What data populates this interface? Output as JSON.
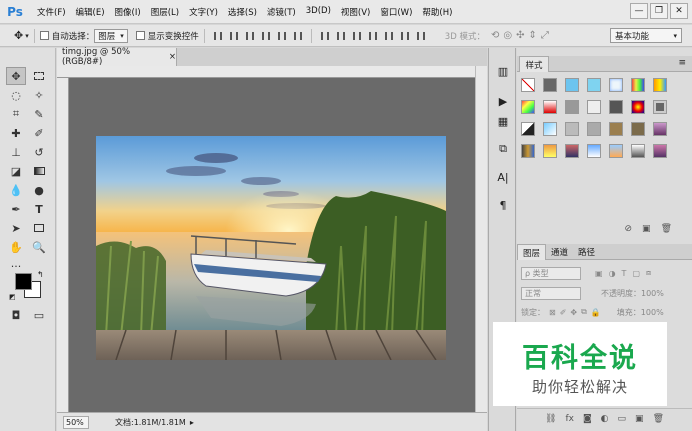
{
  "app": {
    "logo": "Ps"
  },
  "menu": [
    "文件(F)",
    "编辑(E)",
    "图像(I)",
    "图层(L)",
    "文字(Y)",
    "选择(S)",
    "滤镜(T)",
    "3D(D)",
    "视图(V)",
    "窗口(W)",
    "帮助(H)"
  ],
  "window_controls": {
    "minimize": "—",
    "restore": "❐",
    "close": "✕"
  },
  "options": {
    "auto_select_label": "自动选择：",
    "auto_select_value": "图层",
    "show_transform_label": "显示变换控件",
    "mode_3d_label": "3D 模式：",
    "workspace": "基本功能"
  },
  "document": {
    "tab_title": "timg.jpg @ 50%(RGB/8#)",
    "close_glyph": "×",
    "zoom": "50%",
    "doc_info": "文档:1.81M/1.81M"
  },
  "panels": {
    "styles_tab": "样式",
    "layers_tabs": [
      "图层",
      "通道",
      "路径"
    ],
    "layer_kind_filter": "ρ 类型",
    "blend_mode": "正常",
    "opacity_label": "不透明度：",
    "opacity_value": "100%",
    "lock_label": "锁定：",
    "fill_label": "填充：",
    "fill_value": "100%"
  },
  "watermark": {
    "title": "百科全说",
    "subtitle": "助你轻松解决"
  },
  "colors": {
    "foreground": "#000000",
    "background": "#ffffff",
    "accent": "#1aa84e"
  },
  "icons": {
    "tools": [
      "move-icon",
      "marquee-icon",
      "lasso-icon",
      "magic-wand-icon",
      "crop-icon",
      "eyedropper-icon",
      "healing-brush-icon",
      "brush-icon",
      "clone-stamp-icon",
      "history-brush-icon",
      "eraser-icon",
      "gradient-icon",
      "blur-icon",
      "dodge-icon",
      "pen-icon",
      "type-icon",
      "path-select-icon",
      "shape-icon",
      "hand-icon",
      "zoom-icon",
      "more-tools-icon"
    ]
  }
}
